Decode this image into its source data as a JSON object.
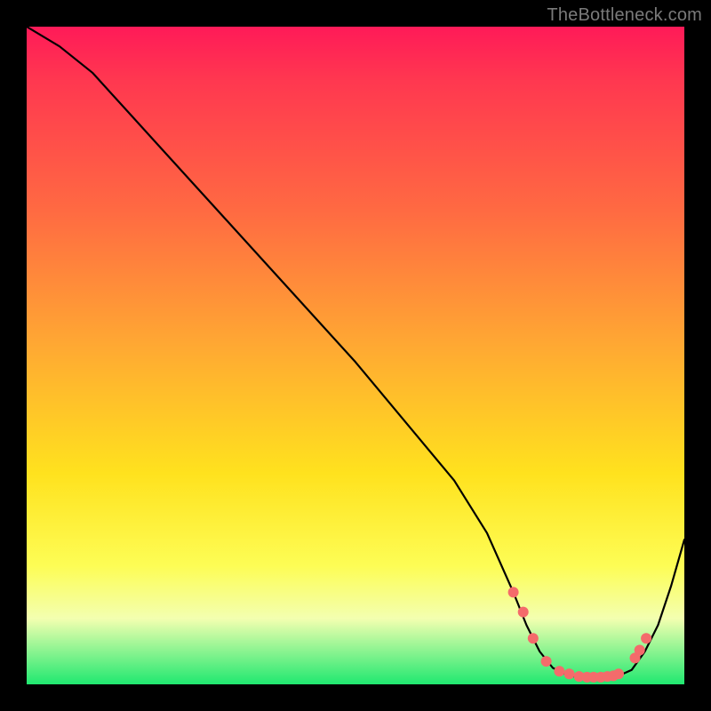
{
  "attribution": "TheBottleneck.com",
  "chart_data": {
    "type": "line",
    "title": "",
    "xlabel": "",
    "ylabel": "",
    "xlim": [
      0,
      100
    ],
    "ylim": [
      0,
      100
    ],
    "series": [
      {
        "name": "bottleneck-curve",
        "x": [
          0,
          5,
          10,
          20,
          30,
          40,
          50,
          60,
          65,
          70,
          74,
          76,
          78,
          80,
          82,
          84,
          86,
          88,
          90,
          92,
          94,
          96,
          98,
          100
        ],
        "y": [
          100,
          97,
          93,
          82,
          71,
          60,
          49,
          37,
          31,
          23,
          14,
          9,
          5,
          2.5,
          1.5,
          1,
          1,
          1,
          1.3,
          2.2,
          5,
          9,
          15,
          22
        ]
      }
    ],
    "markers": {
      "name": "highlight-dots",
      "x": [
        74,
        75.5,
        77,
        79,
        81,
        82.5,
        84,
        85.2,
        86.2,
        87.3,
        88.3,
        89.2,
        90,
        92.5,
        93.2,
        94.2
      ],
      "y": [
        14,
        11,
        7,
        3.5,
        2,
        1.6,
        1.2,
        1.1,
        1.1,
        1.1,
        1.2,
        1.3,
        1.6,
        4,
        5.2,
        7
      ]
    }
  },
  "colors": {
    "curve_stroke": "#000000",
    "marker_fill": "#f46b6b"
  }
}
